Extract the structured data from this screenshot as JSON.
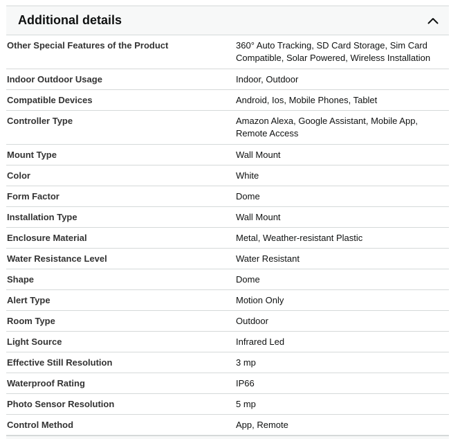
{
  "section": {
    "title": "Additional details",
    "toggle_icon": "chevron-up-icon"
  },
  "details": [
    {
      "key": "Other Special Features of the Product",
      "value": "360° Auto Tracking, SD Card Storage, Sim Card Compatible, Solar Powered, Wireless Installation"
    },
    {
      "key": "Indoor Outdoor Usage",
      "value": "Indoor, Outdoor"
    },
    {
      "key": "Compatible Devices",
      "value": "Android, Ios, Mobile Phones, Tablet"
    },
    {
      "key": "Controller Type",
      "value": "Amazon Alexa, Google Assistant, Mobile App, Remote Access"
    },
    {
      "key": "Mount Type",
      "value": "Wall Mount"
    },
    {
      "key": "Color",
      "value": "White"
    },
    {
      "key": "Form Factor",
      "value": "Dome"
    },
    {
      "key": "Installation Type",
      "value": "Wall Mount"
    },
    {
      "key": "Enclosure Material",
      "value": "Metal, Weather-resistant Plastic"
    },
    {
      "key": "Water Resistance Level",
      "value": "Water Resistant"
    },
    {
      "key": "Shape",
      "value": "Dome"
    },
    {
      "key": "Alert Type",
      "value": "Motion Only"
    },
    {
      "key": "Room Type",
      "value": "Outdoor"
    },
    {
      "key": "Light Source",
      "value": "Infrared Led"
    },
    {
      "key": "Effective Still Resolution",
      "value": "3 mp"
    },
    {
      "key": "Waterproof Rating",
      "value": "IP66"
    },
    {
      "key": "Photo Sensor Resolution",
      "value": "5 mp"
    },
    {
      "key": "Control Method",
      "value": "App, Remote"
    }
  ]
}
